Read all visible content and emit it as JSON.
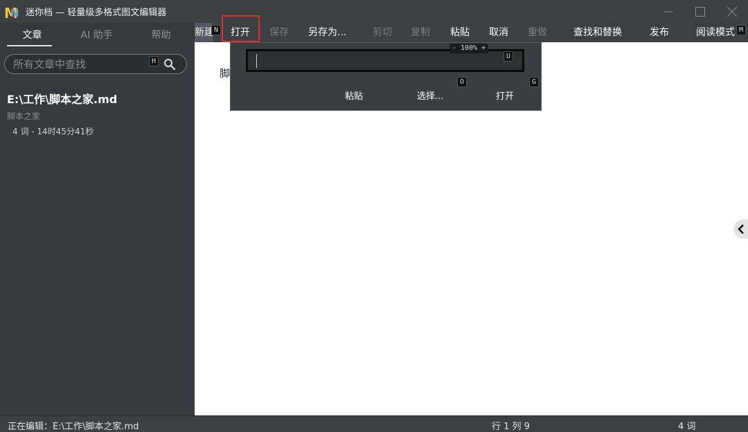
{
  "window": {
    "title": "迷你档 — 轻量级多格式图文编辑器",
    "logo_letters": "MN",
    "minimize_icon": "minimize-icon",
    "maximize_icon": "maximize-icon",
    "close_icon": "close-icon"
  },
  "sidebar": {
    "tabs": [
      {
        "label": "文章",
        "active": true
      },
      {
        "label": "AI 助手",
        "active": false
      },
      {
        "label": "帮助",
        "active": false
      }
    ],
    "search": {
      "placeholder": "所有文章中查找",
      "hotkey": "H",
      "icon": "search-icon"
    },
    "documents": [
      {
        "title": "E:\\工作\\脚本之家.md",
        "subtitle": "脚本之家",
        "meta": "4 词 - 14时45分41秒"
      }
    ]
  },
  "menubar": {
    "items": [
      {
        "label": "新建",
        "hotkey": "N",
        "enabled": true
      },
      {
        "label": "打开",
        "enabled": true
      },
      {
        "label": "保存",
        "enabled": false
      },
      {
        "label": "另存为...",
        "enabled": true
      },
      {
        "label": "剪切",
        "enabled": false
      },
      {
        "label": "复制",
        "enabled": false
      },
      {
        "label": "粘贴",
        "enabled": true
      },
      {
        "label": "取消",
        "enabled": true
      },
      {
        "label": "重做",
        "enabled": false
      },
      {
        "label": "查找和替换",
        "enabled": true
      },
      {
        "label": "发布",
        "enabled": true
      },
      {
        "label": "阅读模式",
        "hotkey": "M",
        "enabled": true
      }
    ]
  },
  "open_dropdown": {
    "path_value": "",
    "zoom_label": "- 100% +",
    "field_hotkey": "U",
    "buttons": [
      {
        "label": "粘贴"
      },
      {
        "label": "选择...",
        "hotkey": "O"
      },
      {
        "label": "打开",
        "hotkey": "G"
      }
    ]
  },
  "editor": {
    "content_visible": "脚"
  },
  "statusbar": {
    "editing": "正在编辑：E:\\工作\\脚本之家.md",
    "position": "行 1 列 9",
    "words": "4 词"
  },
  "colors": {
    "highlight": "#e03030",
    "accent_logo": "#f2c230"
  }
}
